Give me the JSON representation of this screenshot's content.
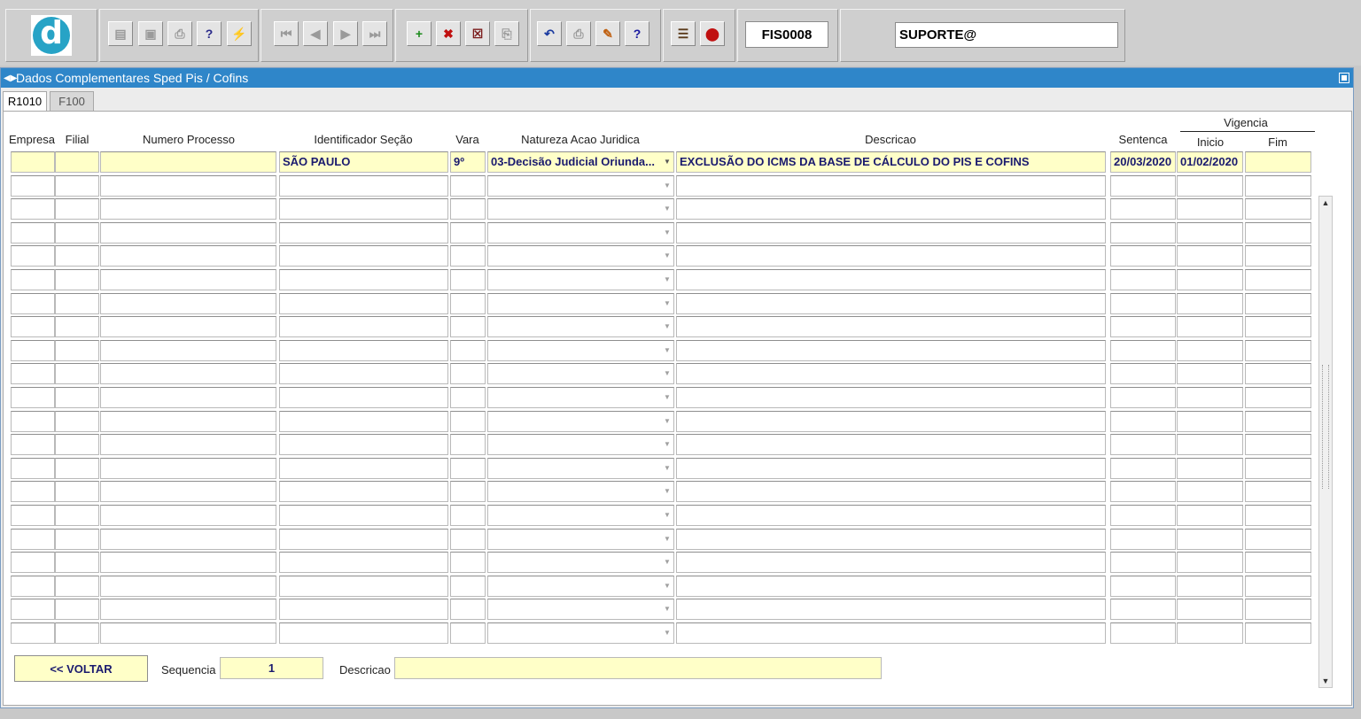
{
  "toolbar": {
    "logo_letter": "d",
    "form_code": "FIS0008",
    "user": "SUPORTE@",
    "buttons": [
      {
        "name": "save-icon",
        "glyph": "▤"
      },
      {
        "name": "window-icon",
        "glyph": "▣"
      },
      {
        "name": "print-icon",
        "glyph": "⎙"
      },
      {
        "name": "query-icon",
        "glyph": "?"
      },
      {
        "name": "execute-query-icon",
        "glyph": "⚡"
      },
      {
        "name": "first-record-icon",
        "glyph": "⏮"
      },
      {
        "name": "previous-record-icon",
        "glyph": "◀"
      },
      {
        "name": "next-record-icon",
        "glyph": "▶"
      },
      {
        "name": "last-record-icon",
        "glyph": "⏭"
      },
      {
        "name": "insert-record-icon",
        "glyph": "+"
      },
      {
        "name": "delete-record-icon",
        "glyph": "✖"
      },
      {
        "name": "clear-record-icon",
        "glyph": "☒"
      },
      {
        "name": "duplicate-record-icon",
        "glyph": "⎘"
      },
      {
        "name": "undo-icon",
        "glyph": "↶"
      },
      {
        "name": "clipboard-icon",
        "glyph": "⎙"
      },
      {
        "name": "edit-icon",
        "glyph": "✎"
      },
      {
        "name": "help-icon",
        "glyph": "?"
      },
      {
        "name": "menu-icon",
        "glyph": "☰"
      },
      {
        "name": "exit-icon",
        "glyph": "⬤"
      }
    ]
  },
  "window": {
    "title": "Dados Complementares Sped Pis / Cofins",
    "tabs": [
      "R1010",
      "F100"
    ]
  },
  "grid": {
    "headers": {
      "empresa": "Empresa",
      "filial": "Filial",
      "numero_processo": "Numero Processo",
      "identificador_secao": "Identificador Seção",
      "vara": "Vara",
      "natureza": "Natureza Acao Juridica",
      "descricao": "Descricao",
      "sentenca": "Sentenca",
      "vigencia": "Vigencia",
      "inicio": "Inicio",
      "fim": "Fim"
    },
    "rows": [
      {
        "empresa": "",
        "filial": "",
        "numero_processo": "",
        "identificador_secao": "SÃO PAULO",
        "vara": "9º",
        "natureza": "03-Decisão Judicial Oriunda...",
        "descricao": "EXCLUSÃO DO ICMS DA BASE DE CÁLCULO DO PIS E COFINS",
        "sentenca": "20/03/2020",
        "inicio": "01/02/2020",
        "fim": ""
      }
    ],
    "empty_rows": 20
  },
  "footer": {
    "voltar_label": "<< VOLTAR",
    "sequencia_label": "Sequencia",
    "sequencia_value": "1",
    "descricao_label": "Descricao",
    "descricao_value": ""
  },
  "colors": {
    "titlebar": "#2f86c9",
    "highlight": "#ffffc8",
    "text": "#1a1a6e"
  }
}
